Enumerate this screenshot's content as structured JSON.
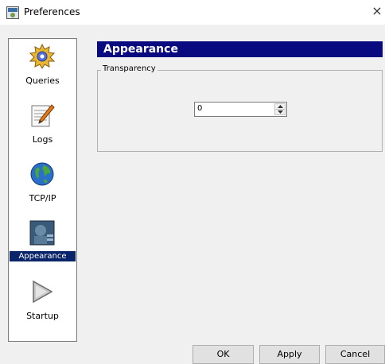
{
  "window": {
    "title": "Preferences",
    "close_glyph": "×"
  },
  "sidebar": {
    "items": [
      {
        "label": "Queries",
        "icon": "gear-icon",
        "selected": false
      },
      {
        "label": "Logs",
        "icon": "log-pencil-icon",
        "selected": false
      },
      {
        "label": "TCP/IP",
        "icon": "globe-icon",
        "selected": false
      },
      {
        "label": "Appearance",
        "icon": "appearance-icon",
        "selected": true
      },
      {
        "label": "Startup",
        "icon": "play-arrow-icon",
        "selected": false
      }
    ]
  },
  "main": {
    "header": "Appearance",
    "group_title": "Transparency",
    "transparency_value": "0"
  },
  "buttons": {
    "ok": "OK",
    "apply": "Apply",
    "cancel": "Cancel"
  },
  "colors": {
    "header_bg": "#0a0a80",
    "selection_bg": "#0a246a",
    "dialog_bg": "#f0f0f0"
  }
}
